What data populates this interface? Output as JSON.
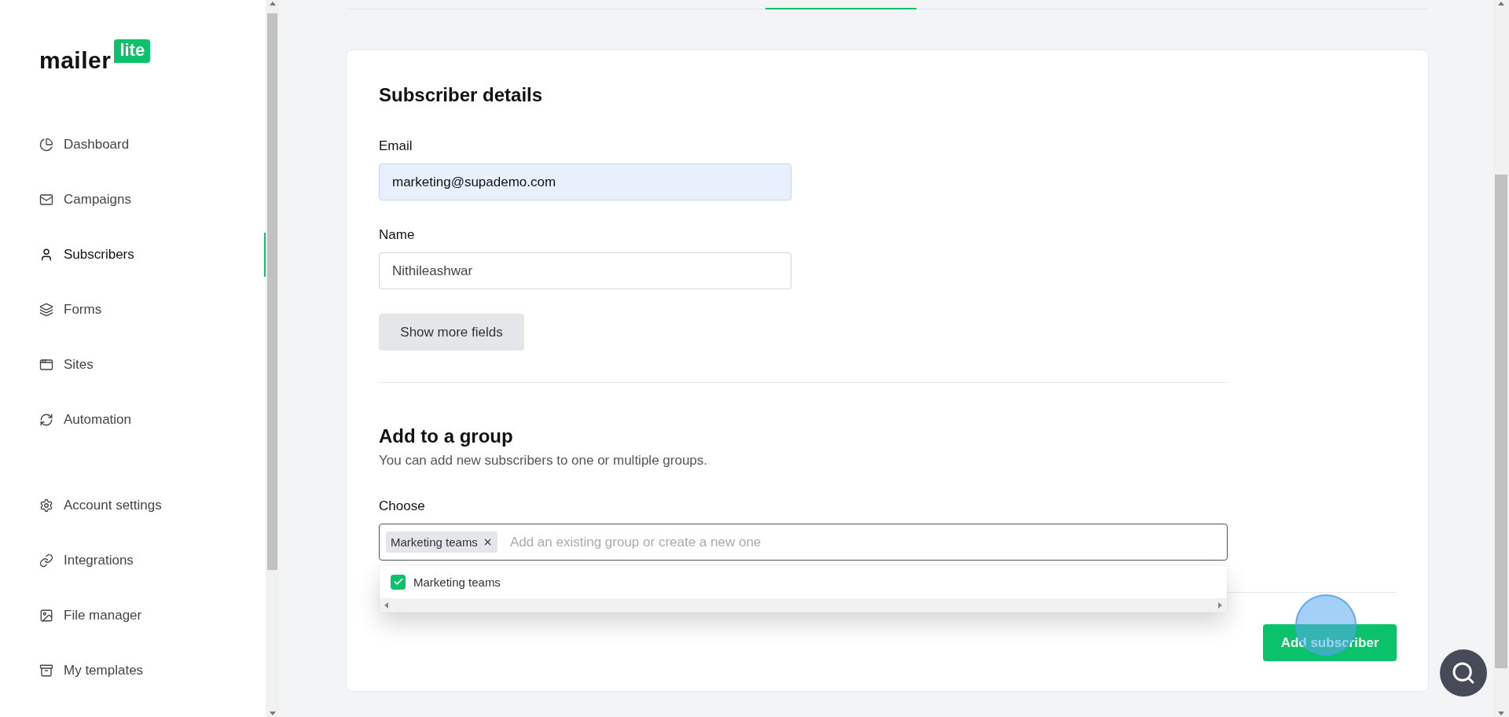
{
  "logo": {
    "word": "mailer",
    "badge": "lite"
  },
  "nav": {
    "primary": [
      {
        "label": "Dashboard",
        "selected": false
      },
      {
        "label": "Campaigns",
        "selected": false
      },
      {
        "label": "Subscribers",
        "selected": true
      },
      {
        "label": "Forms",
        "selected": false
      },
      {
        "label": "Sites",
        "selected": false
      },
      {
        "label": "Automation",
        "selected": false
      }
    ],
    "secondary": [
      {
        "label": "Account settings",
        "selected": false
      },
      {
        "label": "Integrations",
        "selected": false
      },
      {
        "label": "File manager",
        "selected": false
      },
      {
        "label": "My templates",
        "selected": false
      }
    ]
  },
  "details": {
    "title": "Subscriber details",
    "fields": [
      {
        "label": "Email",
        "value": "marketing@supademo.com",
        "autofilled": true
      },
      {
        "label": "Name",
        "value": "Nithileashwar",
        "autofilled": false
      }
    ],
    "more_button": "Show more fields"
  },
  "group": {
    "title": "Add to a group",
    "description": "You can add new subscribers to one or multiple groups.",
    "choose_label": "Choose",
    "tags": [
      {
        "label": "Marketing teams"
      }
    ],
    "placeholder": "Add an existing group or create a new one",
    "options": [
      {
        "label": "Marketing teams",
        "checked": true
      }
    ]
  },
  "submit_button": "Add subscriber"
}
